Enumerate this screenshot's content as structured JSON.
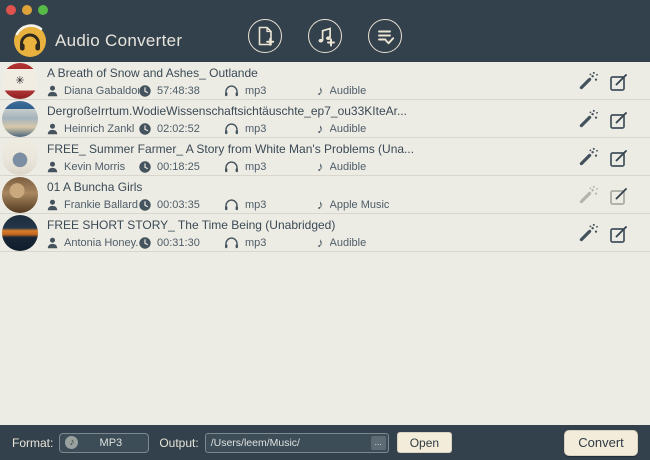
{
  "window": {
    "controls": [
      "close",
      "minimize",
      "zoom"
    ]
  },
  "header": {
    "app_title": "Audio Converter",
    "buttons": [
      {
        "label": "add-file",
        "icon": "document-plus-icon"
      },
      {
        "label": "add-itunes-music",
        "icon": "music-note-plus-icon"
      },
      {
        "label": "task-list",
        "icon": "list-check-icon"
      }
    ]
  },
  "tracks": [
    {
      "title": "A Breath of Snow and Ashes_ Outlande",
      "author": "Diana Gabaldon",
      "duration": "57:48:38",
      "format": "mp3",
      "source": "Audible"
    },
    {
      "title": "DergroßeIrrtum.WodieWissenschaftsichtäuschte_ep7_ou33KIteAr...",
      "author": "Heinrich Zankl",
      "duration": "02:02:52",
      "format": "mp3",
      "source": "Audible"
    },
    {
      "title": "FREE_ Summer Farmer_ A Story from White Man's Problems (Una...",
      "author": "Kevin Morris",
      "duration": "00:18:25",
      "format": "mp3",
      "source": "Audible"
    },
    {
      "title": "01 A Buncha Girls",
      "author": "Frankie Ballard",
      "duration": "00:03:35",
      "format": "mp3",
      "source": "Apple Music"
    },
    {
      "title": "FREE SHORT STORY_ The Time Being (Unabridged)",
      "author": "Antonia Honey...",
      "duration": "00:31:30",
      "format": "mp3",
      "source": "Audible"
    }
  ],
  "footer": {
    "format_label": "Format:",
    "format_value": "MP3",
    "output_label": "Output:",
    "output_value": "/Users/leem/Music/",
    "browse_label": "...",
    "open_label": "Open",
    "convert_label": "Convert"
  },
  "icons": {
    "logo": "headphones-logo",
    "author": "person-icon",
    "duration": "clock-icon",
    "format": "headphones-icon",
    "source": "music-note-icon",
    "effects": "magic-wand-icon",
    "edit": "edit-square-icon",
    "format_selector": "disc-note-icon",
    "browse": "ellipsis-icon"
  },
  "colors": {
    "header_bg": "#33414c",
    "list_bg": "#ecebe4",
    "button_cream": "#f3ecdb",
    "logo_gold": "#e9b13d",
    "title_text": "#3b4a55",
    "meta_text": "#4e5d68",
    "traffic_red": "#e0524d",
    "traffic_yellow": "#dfa23b",
    "traffic_green": "#58bb47"
  },
  "note_glyph": "♪"
}
